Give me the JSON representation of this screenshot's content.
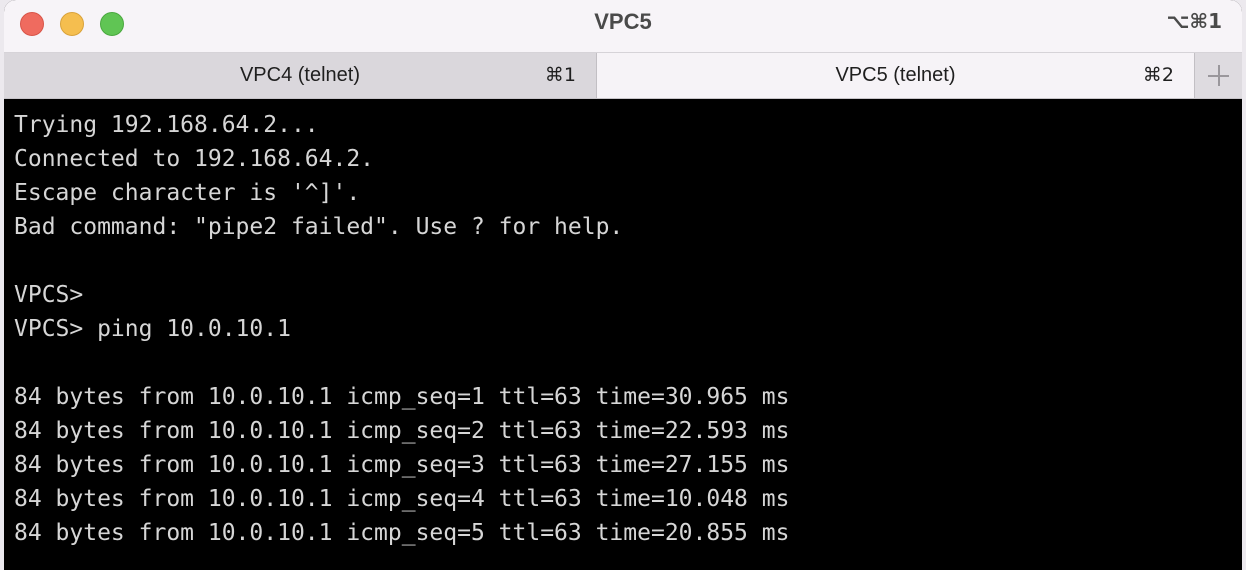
{
  "window": {
    "title": "VPC5",
    "shortcut": "⌥⌘1",
    "traffic_lights": {
      "close_color": "#ef6b5f",
      "minimize_color": "#f5be4f",
      "zoom_color": "#60c554"
    }
  },
  "tabs": [
    {
      "label": "VPC4 (telnet)",
      "shortcut": "⌘1",
      "active": false
    },
    {
      "label": "VPC5 (telnet)",
      "shortcut": "⌘2",
      "active": true
    }
  ],
  "new_tab_icon": "plus-icon",
  "terminal": {
    "lines": [
      "Trying 192.168.64.2...",
      "Connected to 192.168.64.2.",
      "Escape character is '^]'.",
      "Bad command: \"pipe2 failed\". Use ? for help.",
      "",
      "VPCS>",
      "VPCS> ping 10.0.10.1",
      "",
      "84 bytes from 10.0.10.1 icmp_seq=1 ttl=63 time=30.965 ms",
      "84 bytes from 10.0.10.1 icmp_seq=2 ttl=63 time=22.593 ms",
      "84 bytes from 10.0.10.1 icmp_seq=3 ttl=63 time=27.155 ms",
      "84 bytes from 10.0.10.1 icmp_seq=4 ttl=63 time=10.048 ms",
      "84 bytes from 10.0.10.1 icmp_seq=5 ttl=63 time=20.855 ms"
    ],
    "background_color": "#000000",
    "text_color": "#d6d6d6"
  }
}
